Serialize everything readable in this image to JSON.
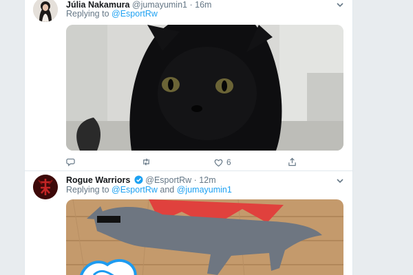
{
  "tweets": [
    {
      "display_name": "Júlia Nakamura",
      "handle": "@jumayumin1",
      "separator": "·",
      "time": "16m",
      "replying_label": "Replying to",
      "replying_to": "@EsportRw",
      "reply_and": "",
      "replying_to_2": "",
      "media_icon": "black-cat-photo",
      "actions": {
        "reply_count": "",
        "retweet_count": "",
        "like_count": "6"
      }
    },
    {
      "display_name": "Rogue Warriors",
      "handle": "@EsportRw",
      "separator": "·",
      "time": "12m",
      "replying_label": "Replying to",
      "replying_to": "@EsportRw",
      "reply_and": "and",
      "replying_to_2": "@jumayumin1",
      "media_icon": "grey-cat-photo"
    }
  ],
  "colors": {
    "link": "#1da1f2",
    "muted": "#657786",
    "text": "#14171a",
    "verified": "#1da1f2"
  }
}
